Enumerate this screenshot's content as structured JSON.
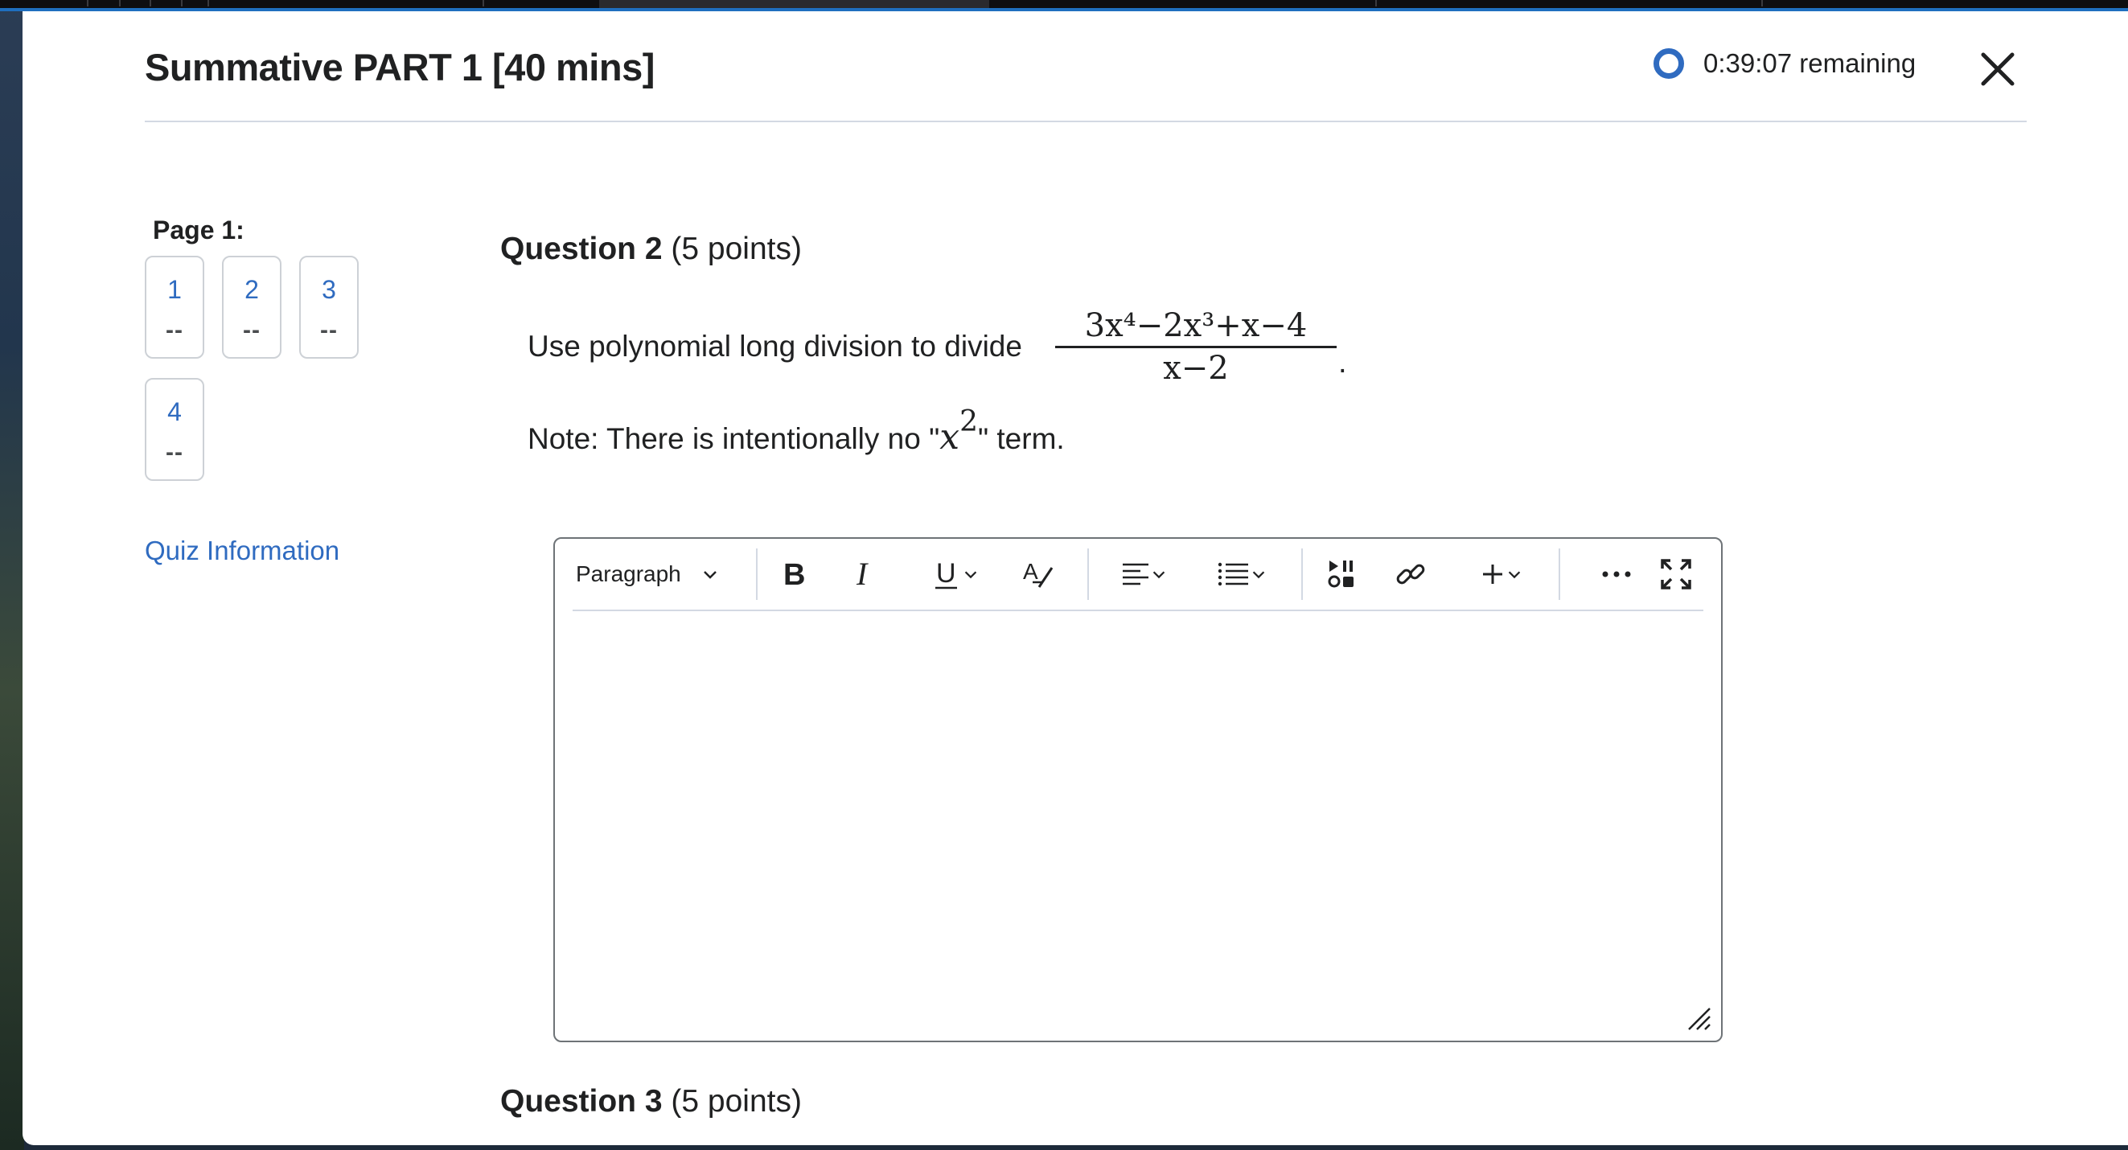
{
  "quiz": {
    "title": "Summative PART 1 [40 mins]",
    "timer_text": "0:39:07 remaining"
  },
  "nav": {
    "page_label": "Page 1:",
    "questions": [
      {
        "number": "1",
        "status": "--"
      },
      {
        "number": "2",
        "status": "--"
      },
      {
        "number": "3",
        "status": "--"
      },
      {
        "number": "4",
        "status": "--"
      }
    ],
    "quiz_info_link": "Quiz Information"
  },
  "question2": {
    "label": "Question 2",
    "points": "(5 points)",
    "prompt": "Use polynomial long division to divide",
    "fraction_numerator": "3x⁴−2x³+x−4",
    "fraction_denominator": "x−2",
    "period": ".",
    "note_prefix": "Note: There is intentionally no \"",
    "note_var": "x",
    "note_exp": "2",
    "note_suffix": "\" term."
  },
  "editor": {
    "block_format": "Paragraph",
    "content": ""
  },
  "question3": {
    "label": "Question 3",
    "points": "(5 points)"
  },
  "colors": {
    "accent": "#2f6bc0",
    "text": "#202122",
    "border": "#cdd1d6",
    "rule": "#d3d9e3"
  },
  "icons": [
    "close-icon",
    "timer-ring-icon",
    "chevron-down-icon",
    "bold-icon",
    "italic-icon",
    "underline-icon",
    "clear-format-icon",
    "align-icon",
    "list-icon",
    "insert-media-icon",
    "link-icon",
    "plus-icon",
    "more-icon",
    "fullscreen-icon",
    "resize-handle-icon"
  ]
}
